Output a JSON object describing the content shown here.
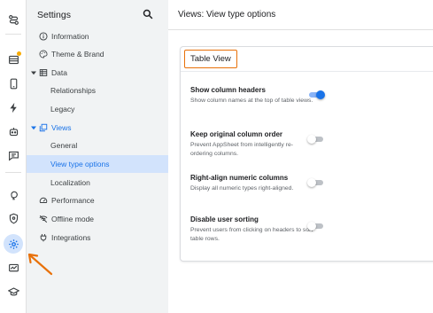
{
  "colors": {
    "accent": "#1a73e8",
    "highlight": "#e8710a",
    "badge": "#f9ab00"
  },
  "rail": {
    "icons": [
      "route-icon",
      "list-icon",
      "phone-icon",
      "bolt-icon",
      "robot-icon",
      "chat-icon",
      "bulb-icon",
      "shield-icon",
      "gear-icon",
      "monitor-icon",
      "school-icon"
    ]
  },
  "settings": {
    "title": "Settings",
    "items": [
      {
        "label": "Information"
      },
      {
        "label": "Theme & Brand"
      },
      {
        "label": "Data"
      },
      {
        "label": "Relationships"
      },
      {
        "label": "Legacy"
      },
      {
        "label": "Views"
      },
      {
        "label": "General"
      },
      {
        "label": "View type options"
      },
      {
        "label": "Localization"
      },
      {
        "label": "Performance"
      },
      {
        "label": "Offline mode"
      },
      {
        "label": "Integrations"
      }
    ]
  },
  "main": {
    "title": "Views: View type options",
    "card_title": "Table View",
    "options": [
      {
        "title": "Show column headers",
        "desc": "Show column names at the top of table views.",
        "enabled": true
      },
      {
        "title": "Keep original column order",
        "desc": "Prevent AppSheet from intelligently re-ordering columns.",
        "enabled": false
      },
      {
        "title": "Right-align numeric columns",
        "desc": "Display all numeric types right-aligned.",
        "enabled": false
      },
      {
        "title": "Disable user sorting",
        "desc": "Prevent users from clicking on headers to sort table rows.",
        "enabled": false
      }
    ]
  }
}
